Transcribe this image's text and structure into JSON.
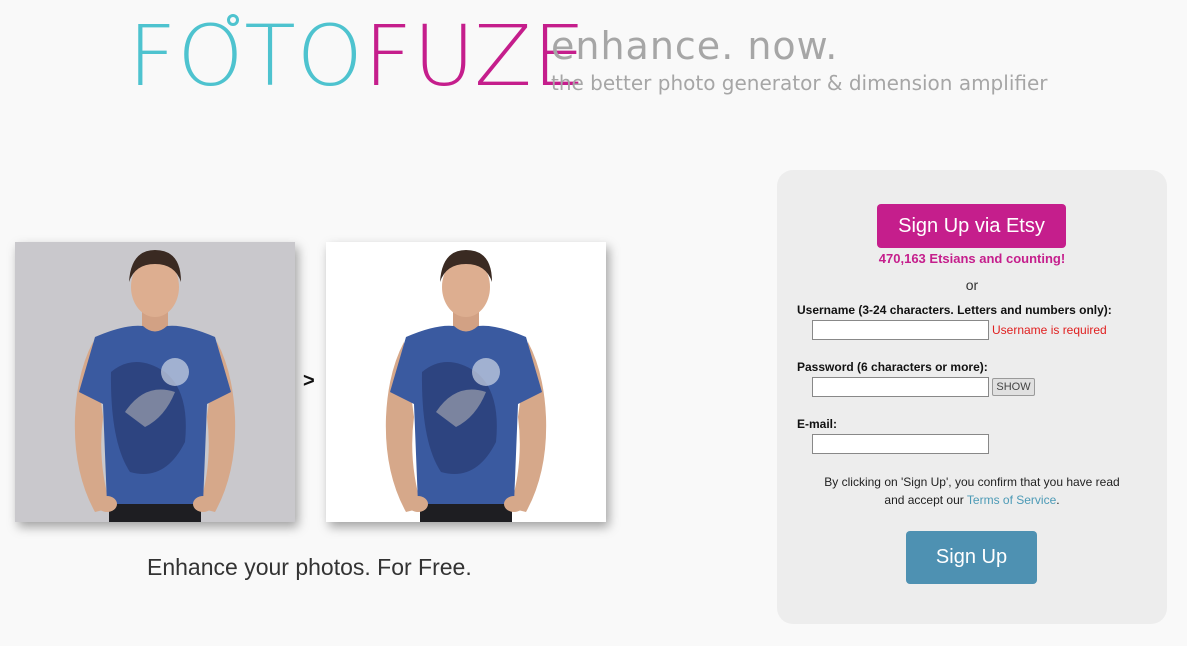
{
  "branding": {
    "logo_part1": "FOTO",
    "logo_part2": "FUZE",
    "tagline": "enhance. now.",
    "subtagline": "the better photo generator & dimension amplifier",
    "foto_color": "#4ec3cf",
    "fuze_color": "#c51e8c"
  },
  "hero": {
    "arrow": ">",
    "caption": "Enhance your photos. For Free.",
    "before_image": "man-in-wolf-tshirt-gray-background",
    "after_image": "man-in-wolf-tshirt-white-background"
  },
  "signup": {
    "etsy_button": "Sign Up via Etsy",
    "etsian_count": "470,163 Etsians and counting!",
    "or": "or",
    "username_label": "Username (3-24 characters. Letters and numbers only):",
    "username_value": "",
    "username_error": "Username is required",
    "password_label": "Password (6 characters or more):",
    "password_value": "",
    "show_button": "SHOW",
    "email_label": "E-mail:",
    "email_value": "",
    "tos_text_line1": "By clicking on 'Sign Up', you confirm that you have read",
    "tos_text_line2": "and accept our",
    "tos_link": "Terms of Service",
    "tos_period": ".",
    "signup_button": "Sign Up",
    "accent_color": "#c51e8c",
    "button_color": "#4e91b2"
  }
}
